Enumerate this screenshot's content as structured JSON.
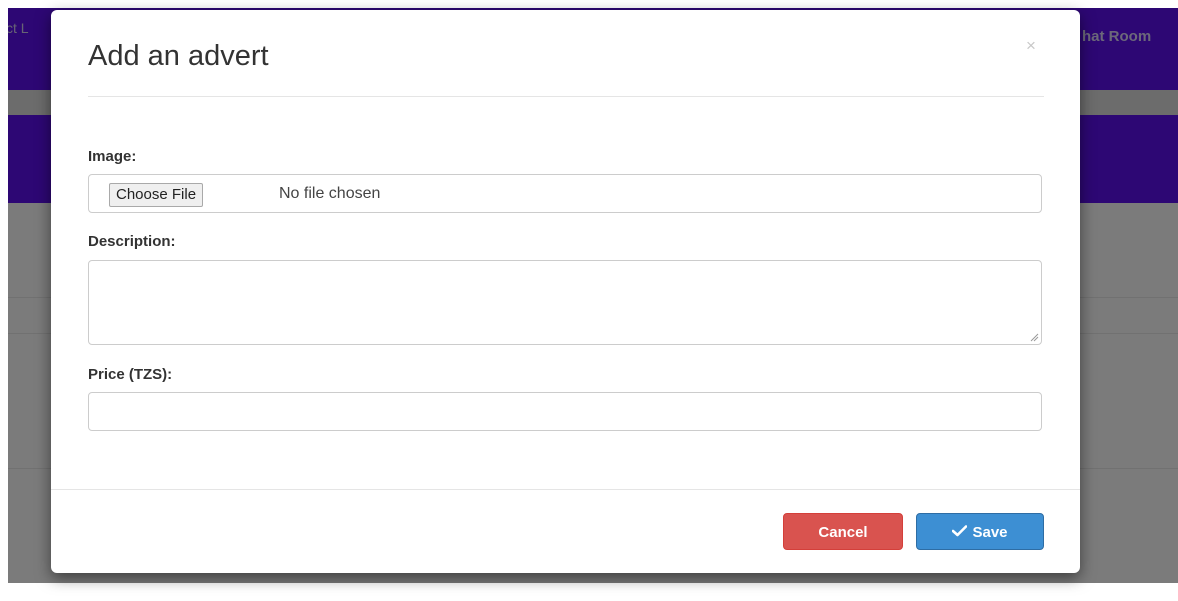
{
  "background": {
    "nav_left_text": "ct L",
    "nav_right_text": "hat Room"
  },
  "modal": {
    "title": "Add an advert",
    "close_symbol": "×",
    "fields": {
      "image_label": "Image:",
      "choose_file_button": "Choose File",
      "file_status": "No file chosen",
      "description_label": "Description:",
      "description_value": "",
      "price_label": "Price (TZS):",
      "price_value": ""
    },
    "footer": {
      "cancel_label": "Cancel",
      "save_label": "Save",
      "save_icon": "check-icon"
    }
  },
  "colors": {
    "nav_purple": "#5b0fe8",
    "cancel_red": "#d9534f",
    "save_blue": "#3d8fd3"
  }
}
